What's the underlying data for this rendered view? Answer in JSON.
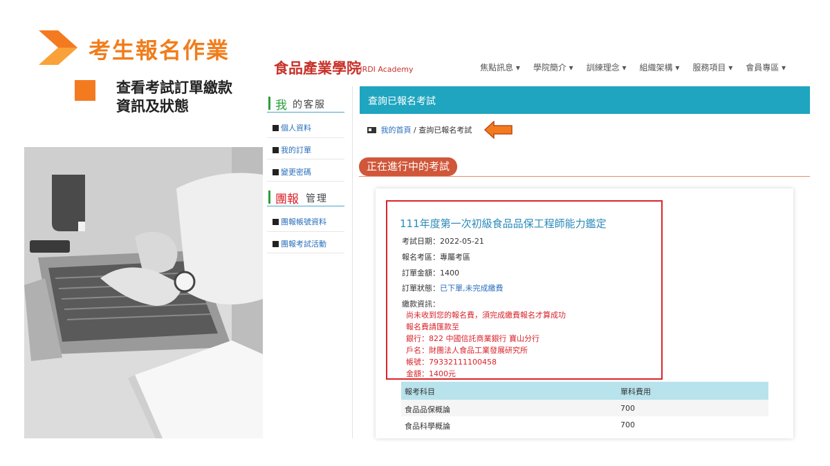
{
  "slide": {
    "title": "考生報名作業",
    "subtitle_line1": "查看考試訂單繳款",
    "subtitle_line2": "資訊及狀態",
    "accent": "#f07d1c"
  },
  "site": {
    "logo_text": "食品產業學院",
    "logo_sub": "FIRDI Academy",
    "nav": [
      "焦點訊息 ▾",
      "學院簡介 ▾",
      "訓練理念 ▾",
      "組織架構 ▾",
      "服務項目 ▾",
      "會員專區 ▾"
    ]
  },
  "sidebar": {
    "section1_big": "我",
    "section1_rest": "的客服",
    "section1_items": [
      "個人資料",
      "我的訂單",
      "變更密碼"
    ],
    "section2_big": "團報",
    "section2_rest": "管理",
    "section2_items": [
      "團報帳號資料",
      "團報考試活動"
    ]
  },
  "panel": {
    "header": "查詢已報名考試",
    "breadcrumb_home": "我的首頁",
    "breadcrumb_sep": "/",
    "breadcrumb_current": "查詢已報名考試",
    "section_title": "正在進行中的考試"
  },
  "exam": {
    "title": "111年度第一次初級食品品保工程師能力鑑定",
    "date_label": "考試日期：",
    "date": "2022-05-21",
    "area_label": "報名考區：",
    "area": "專屬考區",
    "amount_label": "訂單金額：",
    "amount": "1400",
    "status_label": "訂單狀態：",
    "status": "已下單,未完成繳費",
    "payment_label": "繳款資訊：",
    "payment_lines": [
      "尚未收到您的報名費，須完成繳費報名才算成功",
      "報名費請匯款至",
      "銀行：822 中國信託商業銀行 寶山分行",
      "戶名：財團法人食品工業發展研究所",
      "帳號：79332111100458",
      "金額：1400元"
    ]
  },
  "table": {
    "headers": [
      "報考科目",
      "單科費用"
    ],
    "rows": [
      [
        "食品品保概論",
        "700"
      ],
      [
        "食品科學概論",
        "700"
      ]
    ]
  }
}
